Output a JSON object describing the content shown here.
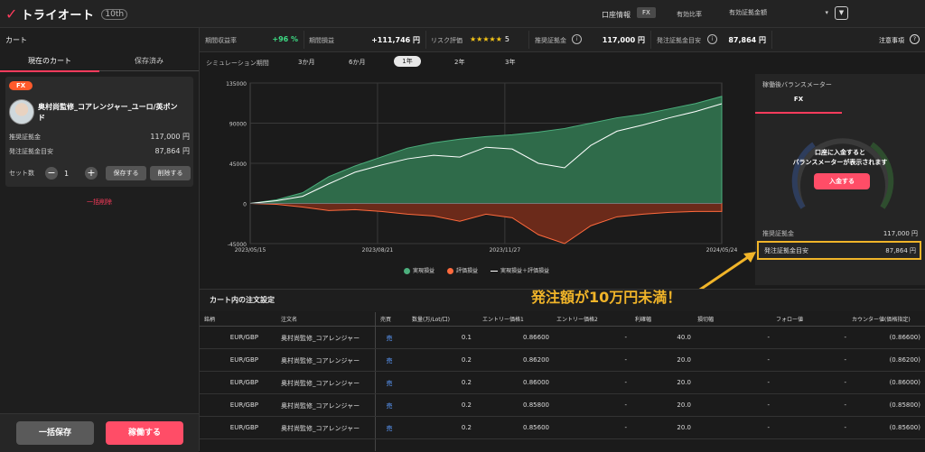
{
  "header": {
    "logo_text": "トライオート",
    "anniversary": "10th",
    "account_label": "口座情報",
    "account_badge": "FX",
    "ratio_label": "有効比率",
    "ratio_select": "有効証拠金額",
    "menu_icon": "chevron-down-icon"
  },
  "cart": {
    "title": "カート",
    "tabs": [
      "現在のカート",
      "保存済み"
    ],
    "card": {
      "badge": "FX",
      "name": "奥村尚監修_コアレンジャー_ユーロ/英ポンド",
      "recommended_label": "推奨証拠金",
      "recommended_value": "117,000 円",
      "order_margin_label": "発注証拠金目安",
      "order_margin_value": "87,864 円",
      "set_label": "セット数",
      "set_count": "1",
      "save_label": "保存する",
      "delete_label": "削除する"
    },
    "bulk_delete": "一括削除",
    "save_all": "一括保存",
    "run": "稼働する"
  },
  "stats": {
    "return_label": "期間収益率",
    "return_value": "+96 %",
    "profit_label": "期間損益",
    "profit_value": "+111,746 円",
    "risk_label": "リスク評価",
    "risk_stars": "★★★★★",
    "risk_value": "5",
    "rec_label": "推奨証拠金",
    "rec_value": "117,000 円",
    "order_label": "発注証拠金目安",
    "order_value": "87,864 円",
    "notice": "注意事項"
  },
  "period": {
    "label": "シミュレーション期間",
    "options": [
      "3か月",
      "6か月",
      "1年",
      "2年",
      "3年"
    ],
    "selected": "1年"
  },
  "chart_data": {
    "type": "area",
    "x": [
      "2023/05/15",
      "2023/08/21",
      "2023/11/27",
      "2024/05/24"
    ],
    "y_ticks": [
      "135000",
      "90000",
      "45000",
      "0",
      "-45000"
    ],
    "ylim": [
      -45000,
      135000
    ],
    "series": [
      {
        "name": "実現損益",
        "color": "#4caf7d",
        "values": [
          0,
          4000,
          12000,
          30000,
          42000,
          52000,
          62000,
          68000,
          72000,
          75000,
          77000,
          80000,
          84000,
          90000,
          96000,
          100000,
          106000,
          112000,
          120000
        ]
      },
      {
        "name": "評価損益",
        "color": "#ff6a3d",
        "values": [
          0,
          -1000,
          -4000,
          -8000,
          -7000,
          -9000,
          -12000,
          -14000,
          -20000,
          -12000,
          -16000,
          -35000,
          -45000,
          -25000,
          -15000,
          -12000,
          -10000,
          -9000,
          -9000
        ]
      },
      {
        "name": "実現損益＋評価損益",
        "color": "#ffffff",
        "values": [
          0,
          3000,
          8000,
          22000,
          35000,
          43000,
          50000,
          54000,
          52000,
          63000,
          61000,
          45000,
          40000,
          65000,
          81000,
          88000,
          96000,
          103000,
          111746
        ]
      }
    ]
  },
  "meter": {
    "title": "稼働後バランスメーター",
    "tab": "FX",
    "message_line1": "口座に入金すると",
    "message_line2": "バランスメーターが表示されます",
    "deposit": "入金する",
    "rec_label": "推奨証拠金",
    "rec_value": "117,000 円",
    "order_label": "発注証拠金目安",
    "order_value": "87,864 円"
  },
  "annotation": "発注額が10万円未満！",
  "orders": {
    "title": "カート内の注文設定",
    "columns": [
      "銘柄",
      "注文名",
      "売買",
      "数量(万/Lot/口)",
      "エントリー価格1",
      "エントリー価格2",
      "利確幅",
      "損切幅",
      "フォロー値",
      "カウンター値(価格指定)"
    ],
    "rows": [
      {
        "pair": "EUR/GBP",
        "name": "奥村尚監修_コアレンジャー",
        "side": "売",
        "qty": "0.1",
        "entry1": "0.86600",
        "entry2": "-",
        "tp": "40.0",
        "sl": "-",
        "follow": "-",
        "counter": "(0.86600)"
      },
      {
        "pair": "EUR/GBP",
        "name": "奥村尚監修_コアレンジャー",
        "side": "売",
        "qty": "0.2",
        "entry1": "0.86200",
        "entry2": "-",
        "tp": "20.0",
        "sl": "-",
        "follow": "-",
        "counter": "(0.86200)"
      },
      {
        "pair": "EUR/GBP",
        "name": "奥村尚監修_コアレンジャー",
        "side": "売",
        "qty": "0.2",
        "entry1": "0.86000",
        "entry2": "-",
        "tp": "20.0",
        "sl": "-",
        "follow": "-",
        "counter": "(0.86000)"
      },
      {
        "pair": "EUR/GBP",
        "name": "奥村尚監修_コアレンジャー",
        "side": "売",
        "qty": "0.2",
        "entry1": "0.85800",
        "entry2": "-",
        "tp": "20.0",
        "sl": "-",
        "follow": "-",
        "counter": "(0.85800)"
      },
      {
        "pair": "EUR/GBP",
        "name": "奥村尚監修_コアレンジャー",
        "side": "売",
        "qty": "0.2",
        "entry1": "0.85600",
        "entry2": "-",
        "tp": "20.0",
        "sl": "-",
        "follow": "-",
        "counter": "(0.85600)"
      }
    ]
  }
}
